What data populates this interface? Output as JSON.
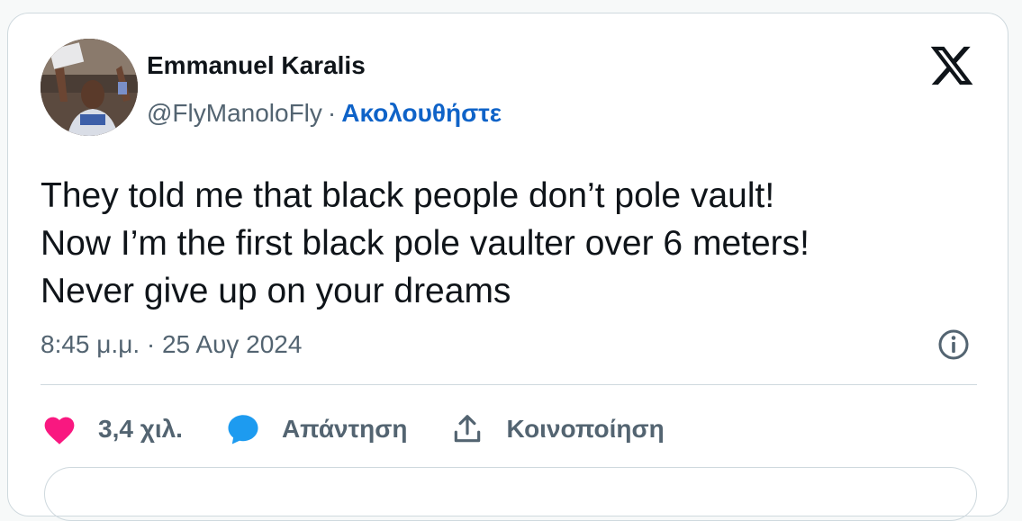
{
  "author": {
    "name": "Emmanuel Karalis",
    "handle": "@FlyManoloFly",
    "separator": "·",
    "follow_label": "Ακολουθήστε"
  },
  "tweet": {
    "lines": [
      "They told me that black people don’t pole vault!",
      "Now I’m the first black pole vaulter over 6 meters!",
      "Never give up on your dreams"
    ],
    "timestamp": "8:45 μ.μ. · 25 Αυγ 2024"
  },
  "actions": {
    "likes_count": "3,4 χιλ.",
    "reply_label": "Απάντηση",
    "share_label": "Κοινοποίηση"
  },
  "icons": {
    "brand": "x-logo-icon",
    "info": "info-icon",
    "like": "heart-icon",
    "reply": "speech-bubble-icon",
    "share": "share-icon"
  },
  "colors": {
    "text_primary": "#0f1419",
    "text_secondary": "#536471",
    "link": "#0f63c8",
    "like": "#f91880",
    "reply": "#1d9bf0",
    "border": "#cfd9de"
  }
}
